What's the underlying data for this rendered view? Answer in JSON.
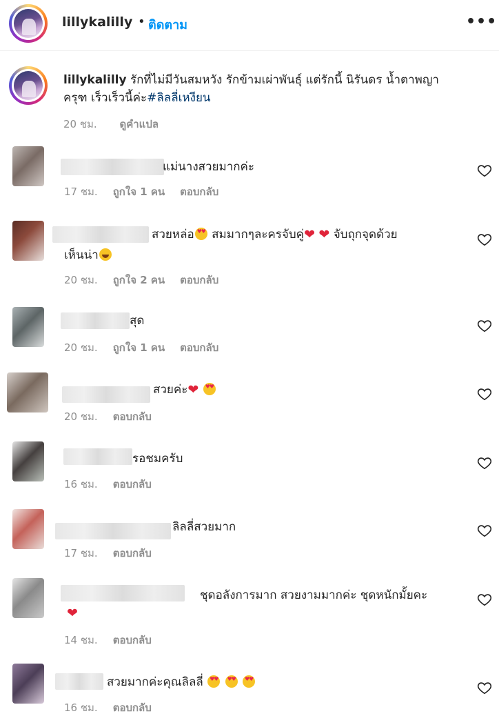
{
  "header": {
    "username": "lillykalilly",
    "separator": "•",
    "follow_label": "ติดตาม",
    "more_label": "•••"
  },
  "caption": {
    "username": "lillykalilly",
    "text_line1": "รักที่ไม่มีวันสมหวัง รักข้ามเผ่าพันธุ์ แต่รักนี้ นิรันดร น้ำตาพญา",
    "text_line2": "ครุฑ เร็วเร็วนี้ค่ะ",
    "hashtag": "#ลิลลี่เหงียน",
    "time": "20 ชม.",
    "translate_label": "ดูคำแปล"
  },
  "comments": [
    {
      "text": "แม่นางสวยมากค่ะ",
      "time": "17 ชม.",
      "likes": "ถูกใจ 1 คน",
      "reply": "ตอบกลับ"
    },
    {
      "text": "สวยหล่อ",
      "text_b": "สมมากๆละครจับคู่",
      "text_c": "จับถุกจุดด้วย",
      "text_line2": "เห็นน่า",
      "time": "20 ชม.",
      "likes": "ถูกใจ 2 คน",
      "reply": "ตอบกลับ"
    },
    {
      "text": "สุด",
      "time": "20 ชม.",
      "likes": "ถูกใจ 1 คน",
      "reply": "ตอบกลับ"
    },
    {
      "text": "สวยค่ะ",
      "time": "20 ชม.",
      "reply": "ตอบกลับ"
    },
    {
      "text": "รอชมครับ",
      "time": "16 ชม.",
      "reply": "ตอบกลับ"
    },
    {
      "text": "ลิลลี่สวยมาก",
      "time": "17 ชม.",
      "reply": "ตอบกลับ"
    },
    {
      "text": "ชุดอลังการมาก สวยงามมากค่ะ ชุดหนักมั้ยคะ",
      "time": "14 ชม.",
      "reply": "ตอบกลับ"
    },
    {
      "text": "สวยมากค่ะคุณลิลลี่",
      "time": "16 ชม.",
      "reply": "ตอบกลับ"
    }
  ],
  "icons": {
    "like": "heart-outline-icon",
    "more": "more-horizontal-icon"
  },
  "colors": {
    "accent": "#0095f6",
    "hashtag": "#00376b",
    "muted": "#8e8e8e",
    "heart_red": "#e0243a"
  }
}
